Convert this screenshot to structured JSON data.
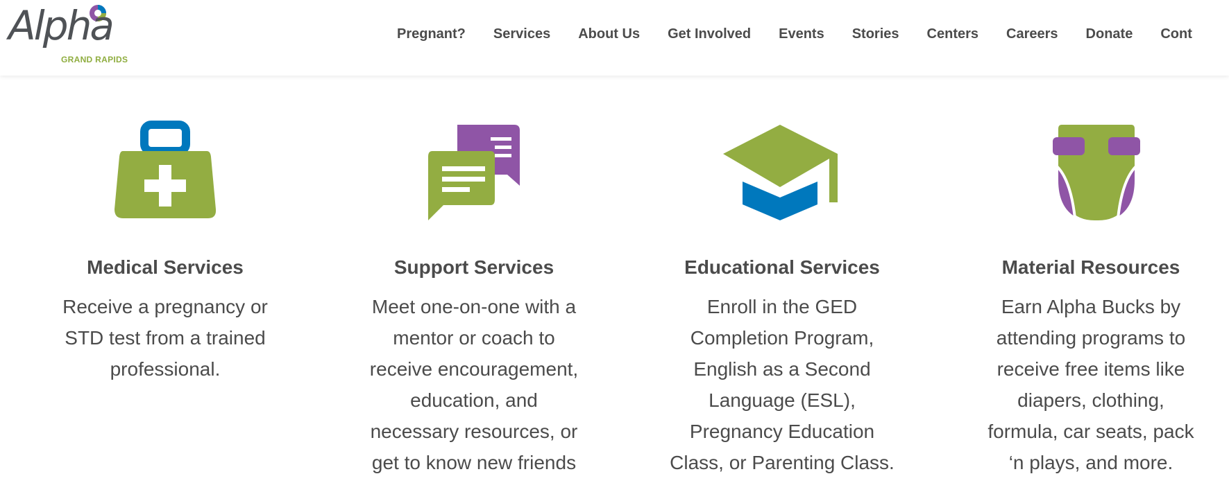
{
  "brand": {
    "name": "Alpha",
    "tagline": "GRAND RAPIDS",
    "colors": {
      "green": "#93ad42",
      "blue": "#0078bd",
      "purple": "#8f55a6",
      "text": "#4b4b4b"
    }
  },
  "nav": {
    "items": [
      "Pregnant?",
      "Services",
      "About Us",
      "Get Involved",
      "Events",
      "Stories",
      "Centers",
      "Careers",
      "Donate",
      "Cont"
    ]
  },
  "services": [
    {
      "icon": "medical-kit-icon",
      "title": "Medical Services",
      "lines": [
        "Receive a pregnancy or",
        "STD test from a trained",
        "professional."
      ]
    },
    {
      "icon": "chat-bubbles-icon",
      "title": "Support Services",
      "lines": [
        "Meet one-on-one with a",
        "mentor or coach to",
        "receive encouragement,",
        "education, and",
        "necessary resources, or",
        "get to know new friends"
      ]
    },
    {
      "icon": "graduation-cap-icon",
      "title": "Educational Services",
      "lines": [
        "Enroll in the GED",
        "Completion Program,",
        "English as a Second",
        "Language (ESL),",
        "Pregnancy Education",
        "Class, or Parenting Class."
      ]
    },
    {
      "icon": "diaper-icon",
      "title": "Material Resources",
      "lines": [
        "Earn Alpha Bucks by",
        "attending programs to",
        "receive free items like",
        "diapers, clothing,",
        "formula, car seats, pack",
        "‘n plays, and more."
      ]
    }
  ]
}
